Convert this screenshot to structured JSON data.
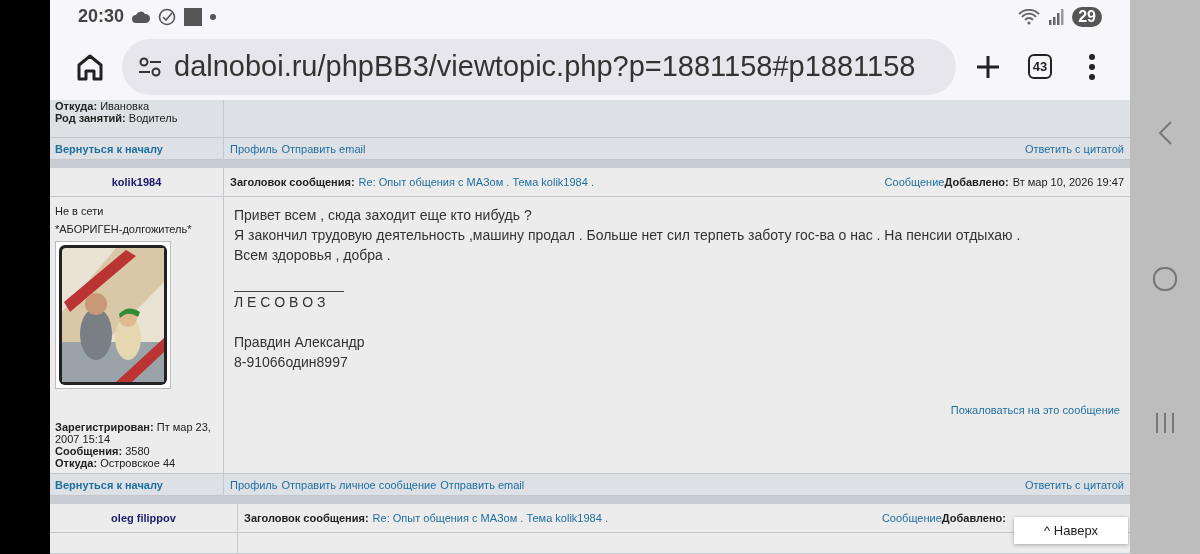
{
  "status_bar": {
    "time": "20:30",
    "battery": "29"
  },
  "browser": {
    "url": "dalnoboi.ru/phpBB3/viewtopic.php?p=1881158#p1881158",
    "tab_count": "43"
  },
  "prev_post": {
    "profile": [
      {
        "label": "Откуда:",
        "value": "Ивановка"
      },
      {
        "label": "Род занятий:",
        "value": "Водитель"
      }
    ],
    "footer": {
      "back": "Вернуться к началу",
      "links": [
        "Профиль",
        "Отправить email"
      ],
      "quote": "Ответить с цитатой"
    }
  },
  "post": {
    "author": "kolik1984",
    "subject_label": "Заголовок сообщения:",
    "subject": "Re: Опыт общения с МАЗом . Тема kolik1984 .",
    "message_link": "Сообщение",
    "added_label": "Добавлено:",
    "added": "Вт мар 10, 2026 19:47",
    "status": "Не в сети",
    "rank": "*АБОРИГЕН-долгожитель*",
    "avatar": {
      "kind": "picture"
    },
    "body": [
      "Привет всем , сюда заходит еще кто нибудь ?",
      "Я закончил трудовую деятельность ,машину продал . Больше нет сил терпеть заботу гос-ва о нас . На пенсии отдыхаю .",
      "Всем здоровья , добра ."
    ],
    "signature": [
      [
        "Л Е С О В О З"
      ],
      [
        "Правдин Александр",
        "8-91066один8997"
      ]
    ],
    "profile": [
      {
        "label": "Зарегистрирован:",
        "value": "Пт мар 23, 2007 15:14"
      },
      {
        "label": "Сообщения:",
        "value": "3580"
      },
      {
        "label": "Откуда:",
        "value": "Островское 44"
      }
    ],
    "report": "Пожаловаться на это сообщение",
    "footer": {
      "back": "Вернуться к началу",
      "links": [
        "Профиль",
        "Отправить личное сообщение",
        "Отправить email"
      ],
      "quote": "Ответить с цитатой"
    }
  },
  "next_post": {
    "author": "oleg filippov",
    "subject_label": "Заголовок сообщения:",
    "subject": "Re: Опыт общения с МАЗом . Тема kolik1984 .",
    "message_link": "Сообщение",
    "added_label": "Добавлено:"
  },
  "scroll_top_button": "^ Наверх"
}
